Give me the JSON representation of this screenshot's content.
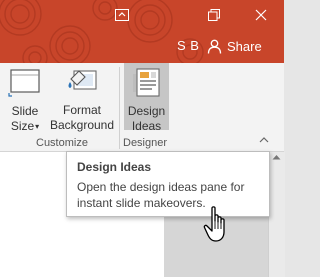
{
  "titlebar": {
    "background_color": "#c8452a",
    "user_initials": "S B",
    "share_label": "Share",
    "controls": {
      "ribbon_display_icon": "ribbon-display-options-icon",
      "restore_icon": "restore-icon",
      "close_icon": "close-icon"
    }
  },
  "ribbon": {
    "slide_size": {
      "label_line1": "Slide",
      "label_line2": "Size",
      "caret": "▾",
      "icon": "slide-size-icon"
    },
    "format_background": {
      "label_line1": "Format",
      "label_line2": "Background",
      "icon": "format-background-icon"
    },
    "design_ideas": {
      "label_line1": "Design",
      "label_line2": "Ideas",
      "icon": "design-ideas-icon",
      "state": "hover"
    },
    "groups": {
      "customize": "Customize",
      "designer": "Designer"
    },
    "collapse_icon": "collapse-ribbon-icon"
  },
  "tooltip": {
    "title": "Design Ideas",
    "body": "Open the design ideas pane for instant slide makeovers."
  },
  "cursor": {
    "type": "hand-pointer"
  }
}
